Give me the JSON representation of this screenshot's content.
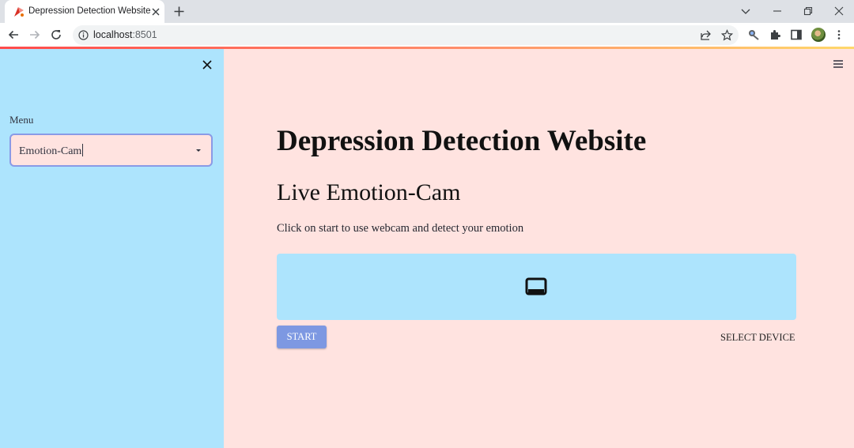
{
  "browser": {
    "tab_title": "Depression Detection Website",
    "url_host": "localhost",
    "url_port": ":8501"
  },
  "sidebar": {
    "menu_label": "Menu",
    "selected_option": "Emotion-Cam"
  },
  "main": {
    "title": "Depression Detection Website",
    "subheader": "Live Emotion-Cam",
    "caption": "Click on start to use webcam and detect your emotion",
    "start_label": "START",
    "select_device_label": "SELECT DEVICE"
  },
  "colors": {
    "sidebar_bg": "#ade4fd",
    "main_bg": "#ffe3e0",
    "start_button": "#7d98e2",
    "select_border": "#8a9ae6"
  },
  "icons": [
    "favicon-icon",
    "close-icon",
    "plus-icon",
    "chevron-down-icon",
    "minimize-icon",
    "restore-icon",
    "back-arrow-icon",
    "forward-arrow-icon",
    "reload-icon",
    "info-icon",
    "share-icon",
    "star-icon",
    "extension-icon",
    "puzzle-icon",
    "side-panel-icon",
    "more-vert-icon",
    "hamburger-menu-icon",
    "video-device-icon"
  ]
}
